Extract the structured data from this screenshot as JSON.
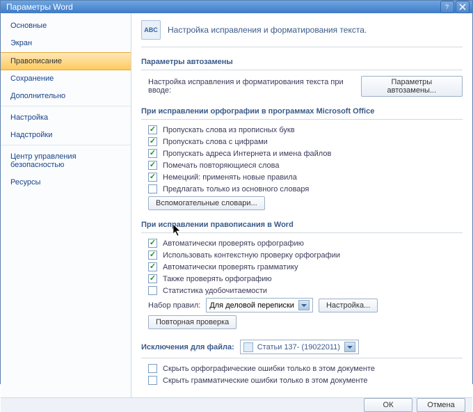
{
  "window": {
    "title": "Параметры Word"
  },
  "sidebar": {
    "items": [
      {
        "label": "Основные"
      },
      {
        "label": "Экран"
      },
      {
        "label": "Правописание",
        "active": true
      },
      {
        "label": "Сохранение"
      },
      {
        "label": "Дополнительно"
      },
      {
        "label": "Настройка"
      },
      {
        "label": "Надстройки"
      },
      {
        "label": "Центр управления безопасностью"
      },
      {
        "label": "Ресурсы"
      }
    ]
  },
  "header": {
    "icon_text": "ABC",
    "title": "Настройка исправления и форматирования текста."
  },
  "section_autocorrect": {
    "title": "Параметры автозамены",
    "description": "Настройка исправления и форматирования текста при вводе:",
    "button": "Параметры автозамены..."
  },
  "section_office": {
    "title": "При исправлении орфографии в программах Microsoft Office",
    "items": [
      {
        "label": "Пропускать слова из прописных букв",
        "checked": true
      },
      {
        "label": "Пропускать слова с цифрами",
        "checked": true
      },
      {
        "label": "Пропускать адреса Интернета и имена файлов",
        "checked": true
      },
      {
        "label": "Помечать повторяющиеся слова",
        "checked": true
      },
      {
        "label": "Немецкий: применять новые правила",
        "checked": true
      },
      {
        "label": "Предлагать только из основного словаря",
        "checked": false
      }
    ],
    "button": "Вспомогательные словари..."
  },
  "section_word": {
    "title": "При исправлении правописания в Word",
    "items": [
      {
        "label": "Автоматически проверять орфографию",
        "checked": true
      },
      {
        "label": "Использовать контекстную проверку орфографии",
        "checked": true
      },
      {
        "label": "Автоматически проверять грамматику",
        "checked": true
      },
      {
        "label": "Также проверять орфографию",
        "checked": true
      },
      {
        "label": "Статистика удобочитаемости",
        "checked": false
      }
    ],
    "rules_label": "Набор правил:",
    "rules_value": "Для деловой переписки",
    "settings_button": "Настройка...",
    "recheck_button": "Повторная проверка"
  },
  "section_exceptions": {
    "title": "Исключения для файла:",
    "file_value": "Статьи 137- (19022011)",
    "items": [
      {
        "label": "Скрыть орфографические ошибки только в этом документе",
        "checked": false
      },
      {
        "label": "Скрыть грамматические ошибки только в этом документе",
        "checked": false
      }
    ]
  },
  "footer": {
    "ok": "ОК",
    "cancel": "Отмена"
  }
}
